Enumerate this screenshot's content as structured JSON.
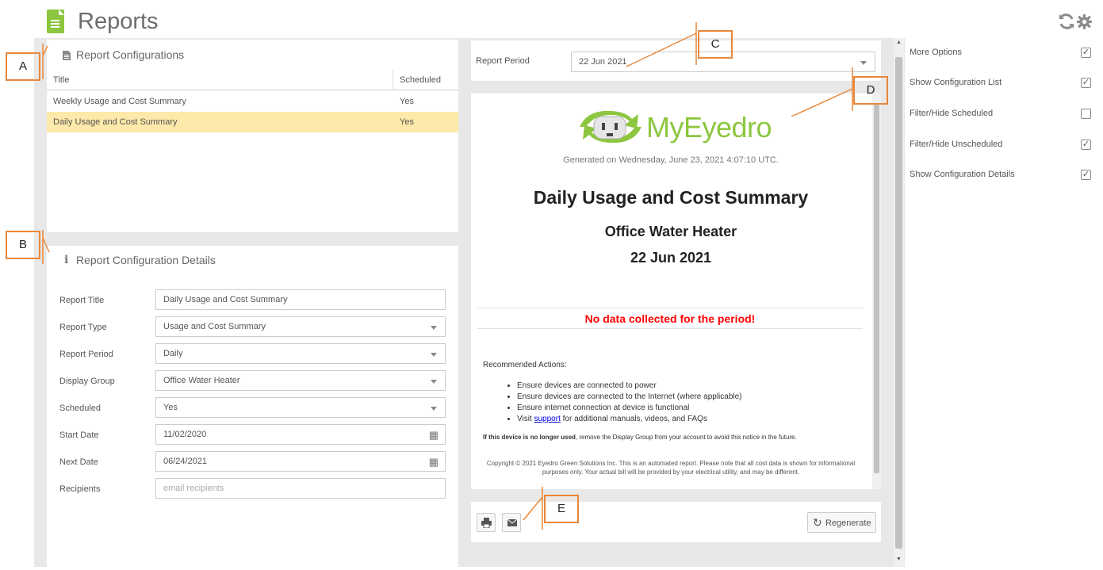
{
  "header": {
    "title": "Reports",
    "refresh_icon": "refresh-icon",
    "settings_icon": "gear-icon"
  },
  "configs": {
    "title": "Report Configurations",
    "columns": {
      "title": "Title",
      "scheduled": "Scheduled"
    },
    "rows": [
      {
        "title": "Weekly Usage and Cost Summary",
        "scheduled": "Yes"
      },
      {
        "title": "Daily Usage and Cost Summary",
        "scheduled": "Yes"
      }
    ]
  },
  "details": {
    "title": "Report Configuration Details",
    "fields": [
      {
        "label": "Report Title",
        "value": "Daily Usage and Cost Summary"
      },
      {
        "label": "Report Type",
        "value": "Usage and Cost Summary"
      },
      {
        "label": "Report Period",
        "value": "Daily"
      },
      {
        "label": "Display Group",
        "value": "Office Water Heater"
      },
      {
        "label": "Scheduled",
        "value": "Yes"
      },
      {
        "label": "Start Date",
        "value": "11/02/2020"
      },
      {
        "label": "Next Date",
        "value": "06/24/2021"
      },
      {
        "label": "Recipients",
        "placeholder": "email recipients"
      }
    ]
  },
  "period": {
    "label": "Report Period",
    "value": "22 Jun 2021"
  },
  "report": {
    "brand": "MyEyedro",
    "generated": "Generated on Wednesday, June 23, 2021 4:07:10 UTC.",
    "title": "Daily Usage and Cost Summary",
    "group": "Office Water Heater",
    "date": "22 Jun 2021",
    "no_data": "No data collected for the period!",
    "actions_heading": "Recommended Actions:",
    "actions": [
      "Ensure devices are connected to power",
      "Ensure devices are connected to the Internet (where applicable)",
      "Ensure internet connection at device is functional"
    ],
    "visit_prefix": "Visit ",
    "support_link": "support",
    "visit_suffix": " for additional manuals, videos, and FAQs",
    "notice_bold": "If this device is no longer used",
    "notice_rest": ", remove the Display Group from your account to avoid this notice in the future.",
    "copyright": "Copyright © 2021 Eyedro Green Solutions Inc. This is an automated report. Please note that all cost data is shown for informational purposes only. Your actual bill will be provided by your electrical utility, and may be different."
  },
  "actions": {
    "regenerate": "Regenerate"
  },
  "options": [
    {
      "label": "More Options",
      "checked": true
    },
    {
      "label": "Show Configuration List",
      "checked": true
    },
    {
      "label": "Filter/Hide Scheduled",
      "checked": false
    },
    {
      "label": "Filter/Hide Unscheduled",
      "checked": true
    },
    {
      "label": "Show Configuration Details",
      "checked": true
    }
  ],
  "callouts": {
    "a": "A",
    "b": "B",
    "c": "C",
    "d": "D",
    "e": "E"
  },
  "colors": {
    "accent": "#8dc63f",
    "selected_row": "#fde9a9",
    "callout": "#e8873a",
    "no_data": "#ff0000"
  }
}
